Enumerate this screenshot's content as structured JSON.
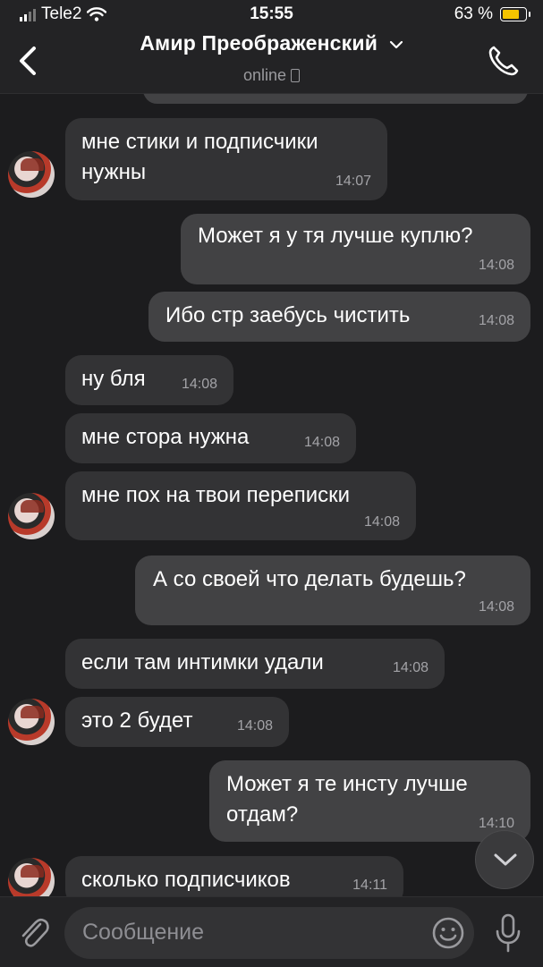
{
  "status": {
    "carrier": "Tele2",
    "time": "15:55",
    "battery": "63 %",
    "battery_level": 0.63
  },
  "header": {
    "name": "Амир Преображенский",
    "status": "online"
  },
  "messages": [
    {
      "dir": "in",
      "text": "мне стики и подписчики нужны",
      "time": "14:07"
    },
    {
      "dir": "out",
      "text": "Может я у тя лучше куплю?",
      "time": "14:08"
    },
    {
      "dir": "out",
      "text": "Ибо стр заебусь чистить",
      "time": "14:08"
    },
    {
      "dir": "in",
      "text": "ну бля",
      "time": "14:08"
    },
    {
      "dir": "in",
      "text": "мне стора нужна",
      "time": "14:08"
    },
    {
      "dir": "in",
      "text": "мне пох на твои переписки",
      "time": "14:08"
    },
    {
      "dir": "out",
      "text": "А со своей что делать будешь?",
      "time": "14:08"
    },
    {
      "dir": "in",
      "text": "если там интимки удали",
      "time": "14:08"
    },
    {
      "dir": "in",
      "text": "это 2 будет",
      "time": "14:08"
    },
    {
      "dir": "out",
      "text": "Может я те инсту лучше отдам?",
      "time": "14:10"
    },
    {
      "dir": "in",
      "text": "сколько подписчиков",
      "time": "14:11"
    }
  ],
  "input": {
    "placeholder": "Сообщение"
  },
  "icons": {
    "back": "chevron-left-icon",
    "title_chevron": "chevron-down-icon",
    "call": "phone-icon",
    "attach": "paperclip-icon",
    "emoji": "smiley-icon",
    "mic": "microphone-icon",
    "scroll": "chevron-down-icon"
  },
  "colors": {
    "background": "#1c1c1e",
    "incoming": "#333335",
    "outgoing": "#424244",
    "battery": "#f5c400"
  }
}
